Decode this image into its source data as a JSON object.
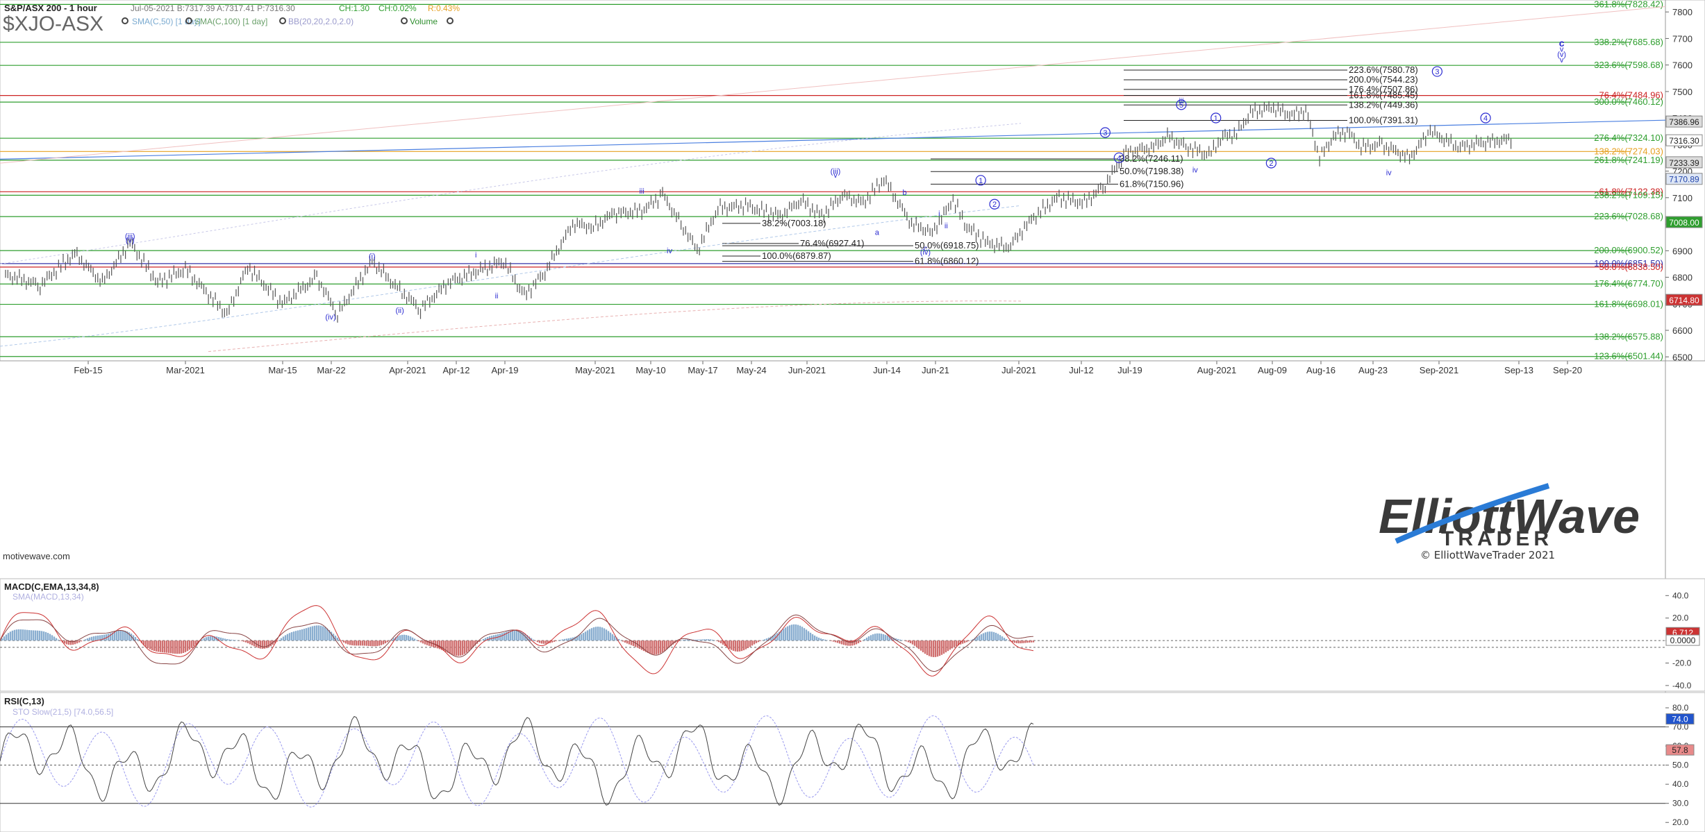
{
  "header": {
    "title": "S&P/ASX 200 - 1 hour",
    "ohlc": "Jul-05-2021 B:7317.39 A:7317.41 P:7316.30",
    "change": "CH:1.30",
    "change_pct": "CH:0.02%",
    "range_pct": "R:0.43%",
    "ticker": "$XJO-ASX",
    "indicators": [
      "SMA(C,50) [1 day]",
      "SMA(C,100) [1 day]",
      "BB(20,20,2.0,2.0)",
      "Volume"
    ]
  },
  "watermark": {
    "line1": "ElliottWave",
    "line2": "TRADER",
    "copyright": "© ElliottWaveTrader 2021"
  },
  "footer_text": "motivewave.com",
  "colors": {
    "price_bar": "#555555",
    "wave_label": "#2b2bd1",
    "fib_green": "#2e9e2e",
    "fib_red": "#cc2222",
    "fib_orange": "#e6a020",
    "trend_blue": "#4a7fe0",
    "macd_fast": "#cc3333",
    "macd_slow": "#884444",
    "hist_pos": "#8aaed0",
    "hist_neg": "#d07070",
    "rsi_line": "#444444",
    "rsi_stoch": "#9999ee"
  },
  "chart_data": [
    {
      "type": "candlestick",
      "title": "S&P/ASX 200 - 1 hour",
      "x_tick_labels": [
        "Feb-15",
        "Mar-2021",
        "Mar-15",
        "Mar-22",
        "Apr-2021",
        "Apr-12",
        "Apr-19",
        "May-2021",
        "May-10",
        "May-17",
        "May-24",
        "Jun-2021",
        "Jun-14",
        "Jun-21",
        "Jul-2021",
        "Jul-12",
        "Jul-19",
        "Aug-2021",
        "Aug-09",
        "Aug-16",
        "Aug-23",
        "Sep-2021",
        "Sep-13",
        "Sep-20"
      ],
      "y_tick_labels": [
        6500,
        6600,
        6700,
        6800,
        6900,
        7000,
        7100,
        7200,
        7300,
        7400,
        7500,
        7600,
        7700,
        7800
      ],
      "ylim": [
        6485,
        7845
      ],
      "price_path": [
        [
          0,
          6810
        ],
        [
          5,
          6770
        ],
        [
          10,
          6890
        ],
        [
          14,
          6780
        ],
        [
          18,
          6930
        ],
        [
          22,
          6780
        ],
        [
          26,
          6830
        ],
        [
          32,
          6660
        ],
        [
          35,
          6840
        ],
        [
          40,
          6700
        ],
        [
          45,
          6800
        ],
        [
          48,
          6660
        ],
        [
          53,
          6860
        ],
        [
          57,
          6750
        ],
        [
          60,
          6680
        ],
        [
          64,
          6780
        ],
        [
          68,
          6820
        ],
        [
          72,
          6860
        ],
        [
          75,
          6730
        ],
        [
          78,
          6820
        ],
        [
          82,
          7000
        ],
        [
          85,
          6990
        ],
        [
          88,
          7040
        ],
        [
          92,
          7050
        ],
        [
          95,
          7110
        ],
        [
          98,
          6990
        ],
        [
          100,
          6900
        ],
        [
          103,
          7060
        ],
        [
          107,
          7070
        ],
        [
          112,
          7030
        ],
        [
          115,
          7090
        ],
        [
          118,
          7030
        ],
        [
          121,
          7110
        ],
        [
          124,
          7080
        ],
        [
          127,
          7170
        ],
        [
          131,
          7000
        ],
        [
          134,
          6970
        ],
        [
          137,
          7090
        ],
        [
          139,
          6990
        ],
        [
          142,
          6930
        ],
        [
          145,
          6910
        ],
        [
          148,
          7010
        ],
        [
          152,
          7100
        ],
        [
          156,
          7080
        ],
        [
          159,
          7150
        ],
        [
          162,
          7270
        ],
        [
          166,
          7290
        ],
        [
          168,
          7330
        ],
        [
          171,
          7290
        ],
        [
          174,
          7260
        ],
        [
          176,
          7330
        ],
        [
          178,
          7340
        ],
        [
          180,
          7420
        ],
        [
          183,
          7440
        ],
        [
          186,
          7410
        ],
        [
          188,
          7430
        ],
        [
          190,
          7250
        ],
        [
          192,
          7330
        ],
        [
          194,
          7350
        ],
        [
          196,
          7290
        ],
        [
          199,
          7300
        ],
        [
          203,
          7250
        ],
        [
          206,
          7350
        ],
        [
          210,
          7290
        ],
        [
          214,
          7310
        ],
        [
          218,
          7320
        ]
      ],
      "wave_labels": [
        {
          "text": "(iii)",
          "x": 18,
          "y": 6945
        },
        {
          "text": "(v)",
          "x": 18,
          "y": 6930
        },
        {
          "text": "(i)",
          "x": 53,
          "y": 6870
        },
        {
          "text": "(iv)",
          "x": 47,
          "y": 6640
        },
        {
          "text": "(ii)",
          "x": 57,
          "y": 6665
        },
        {
          "text": "i",
          "x": 68,
          "y": 6875
        },
        {
          "text": "ii",
          "x": 71,
          "y": 6720
        },
        {
          "text": "iii",
          "x": 92,
          "y": 7115
        },
        {
          "text": "iv",
          "x": 96,
          "y": 6890
        },
        {
          "text": "(iii)",
          "x": 120,
          "y": 7190
        },
        {
          "text": "v",
          "x": 120,
          "y": 7175
        },
        {
          "text": "a",
          "x": 126,
          "y": 6960
        },
        {
          "text": "b",
          "x": 130,
          "y": 7110
        },
        {
          "text": "c",
          "x": 133,
          "y": 6900
        },
        {
          "text": "(iv)",
          "x": 133,
          "y": 6885
        },
        {
          "text": "ii",
          "x": 136,
          "y": 6985
        },
        {
          "text": "i",
          "x": 135,
          "y": 7030
        },
        {
          "text": "1",
          "x": 141,
          "y": 7155
        },
        {
          "text": "2",
          "x": 143,
          "y": 7065
        },
        {
          "text": "3",
          "x": 159,
          "y": 7335
        },
        {
          "text": "4",
          "x": 161,
          "y": 7240
        },
        {
          "text": "5",
          "x": 170,
          "y": 7440
        },
        {
          "text": "iii",
          "x": 170,
          "y": 7455
        },
        {
          "text": "iv",
          "x": 172,
          "y": 7195
        },
        {
          "text": "1",
          "x": 175,
          "y": 7390
        },
        {
          "text": "2",
          "x": 183,
          "y": 7220
        },
        {
          "text": "iv",
          "x": 200,
          "y": 7185
        },
        {
          "text": "4",
          "x": 214,
          "y": 7390
        },
        {
          "text": "3",
          "x": 207,
          "y": 7565
        },
        {
          "text": "c",
          "x": 225,
          "y": 7670
        },
        {
          "text": "v",
          "x": 225,
          "y": 7650
        },
        {
          "text": "(v)",
          "x": 225,
          "y": 7630
        },
        {
          "text": "v",
          "x": 225,
          "y": 7610
        }
      ],
      "right_fib_levels": [
        {
          "label": "361.8%(7828.42)",
          "value": 7828.42,
          "color": "green"
        },
        {
          "label": "338.2%(7685.68)",
          "value": 7685.68,
          "color": "green"
        },
        {
          "label": "323.6%(7598.68)",
          "value": 7598.68,
          "color": "green"
        },
        {
          "label": "76.4%(7484.96)",
          "value": 7484.96,
          "color": "red"
        },
        {
          "label": "300.0%(7460.12)",
          "value": 7460.12,
          "color": "green"
        },
        {
          "label": "276.4%(7324.10)",
          "value": 7324.1,
          "color": "green"
        },
        {
          "label": "138.2%(7274.03)",
          "value": 7274.03,
          "color": "orange"
        },
        {
          "label": "261.8%(7241.19)",
          "value": 7241.19,
          "color": "green"
        },
        {
          "label": "61.8%(7122.38)",
          "value": 7122.38,
          "color": "red"
        },
        {
          "label": "238.2%(7109.15)",
          "value": 7109.15,
          "color": "green"
        },
        {
          "label": "223.6%(7028.68)",
          "value": 7028.68,
          "color": "green"
        },
        {
          "label": "200.0%(6900.52)",
          "value": 6900.52,
          "color": "green"
        },
        {
          "label": "100.0%(6851.50)",
          "value": 6851.5,
          "color": "navy"
        },
        {
          "label": "50.0%(6838.50)",
          "value": 6838.5,
          "color": "red"
        },
        {
          "label": "176.4%(6774.70)",
          "value": 6774.7,
          "color": "green"
        },
        {
          "label": "161.8%(6698.01)",
          "value": 6698.01,
          "color": "green"
        },
        {
          "label": "138.2%(6575.88)",
          "value": 6575.88,
          "color": "green"
        },
        {
          "label": "123.6%(6501.44)",
          "value": 6501.44,
          "color": "green"
        }
      ],
      "inner_fib_levels": [
        {
          "label": "223.6%(7580.78)",
          "value": 7580.78
        },
        {
          "label": "200.0%(7544.23)",
          "value": 7544.23
        },
        {
          "label": "176.4%(7507.86)",
          "value": 7507.86
        },
        {
          "label": "161.8%(7485.45)",
          "value": 7485.45
        },
        {
          "label": "138.2%(7449.36)",
          "value": 7449.36
        },
        {
          "label": "100.0%(7391.31)",
          "value": 7391.31
        },
        {
          "label": "38.2%(7246.11)",
          "value": 7246.11
        },
        {
          "label": "50.0%(7198.38)",
          "value": 7198.38
        },
        {
          "label": "61.8%(7150.96)",
          "value": 7150.96
        },
        {
          "label": "38.2%(7003.18)",
          "value": 7003.18
        },
        {
          "label": "76.4%(6927.41)",
          "value": 6927.41
        },
        {
          "label": "50.0%(6918.75)",
          "value": 6918.75
        },
        {
          "label": "100.0%(6879.87)",
          "value": 6879.87
        },
        {
          "label": "61.8%(6860.12)",
          "value": 6860.12
        }
      ],
      "price_badges": [
        {
          "label": "7386.96",
          "value": 7386.96,
          "style": "gray"
        },
        {
          "label": "7316.30",
          "value": 7316.3,
          "style": "white"
        },
        {
          "label": "7233.39",
          "value": 7233.39,
          "style": "gray"
        },
        {
          "label": "7170.89",
          "value": 7170.89,
          "style": "blue"
        },
        {
          "label": "7008.00",
          "value": 7008.0,
          "style": "green"
        },
        {
          "label": "6714.80",
          "value": 6714.8,
          "style": "red"
        }
      ]
    },
    {
      "type": "line",
      "title": "MACD(C,EMA,13,34,8)",
      "subtitle": "SMA(MACD,13,34)",
      "y_tick_labels": [
        40.0,
        20.0,
        0.0,
        -20.0,
        -40.0
      ],
      "ylim": [
        -45,
        55
      ],
      "badges": [
        {
          "label": "6.712",
          "value": 6.712
        },
        {
          "label": "0.0000",
          "value": 0
        }
      ]
    },
    {
      "type": "line",
      "title": "RSI(C,13)",
      "subtitle": "STO Slow(21,5) [74.0,56.5]",
      "y_tick_labels": [
        80.0,
        70.0,
        60.0,
        50.0,
        40.0,
        30.0,
        20.0
      ],
      "ylim": [
        15,
        88
      ],
      "badges": [
        {
          "label": "74.0",
          "value": 74.0,
          "style": "blue"
        },
        {
          "label": "57.8",
          "value": 57.8,
          "style": "red"
        }
      ]
    }
  ]
}
